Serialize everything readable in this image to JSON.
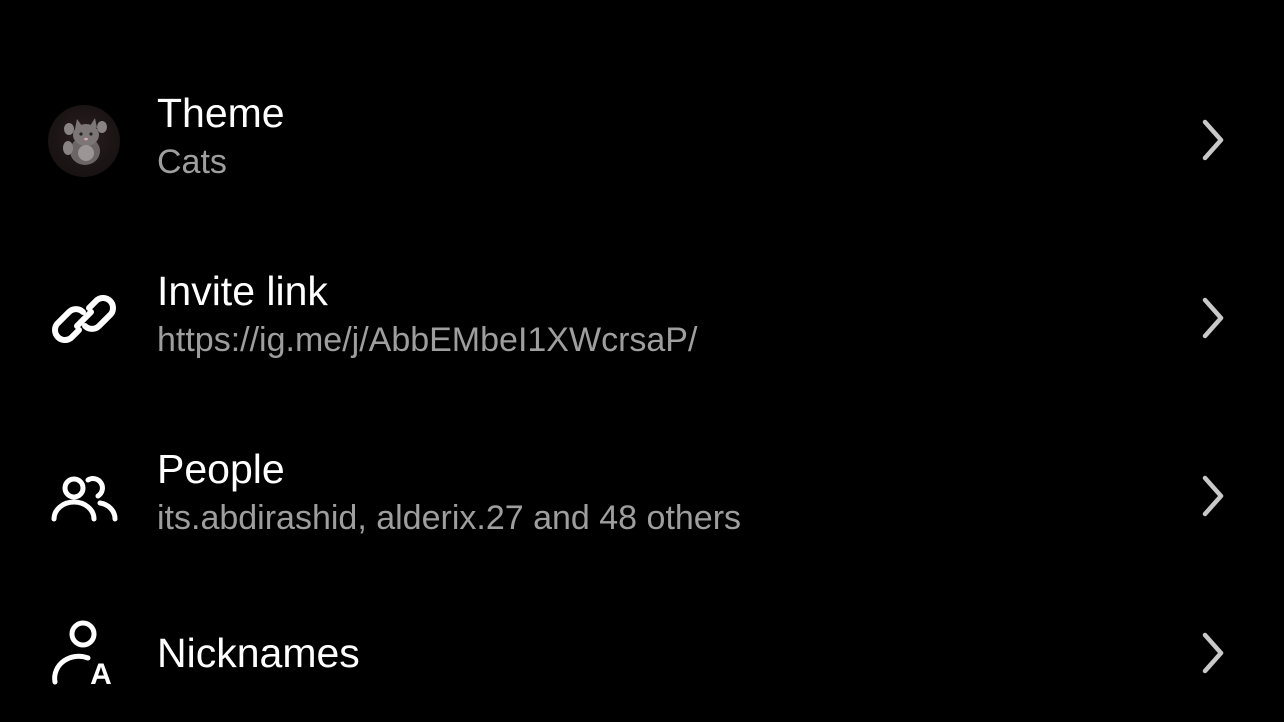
{
  "rows": [
    {
      "title": "Theme",
      "subtitle": "Cats",
      "icon": "cat-avatar-icon"
    },
    {
      "title": "Invite link",
      "subtitle": "https://ig.me/j/AbbEMbeI1XWcrsaP/",
      "icon": "link-icon"
    },
    {
      "title": "People",
      "subtitle": "its.abdirashid, alderix.27 and 48 others",
      "icon": "people-icon"
    },
    {
      "title": "Nicknames",
      "subtitle": "",
      "icon": "nickname-icon"
    }
  ],
  "colors": {
    "background": "#000000",
    "title": "#ffffff",
    "subtitle": "#9e9e9e",
    "chevron": "#c8c8c8"
  }
}
